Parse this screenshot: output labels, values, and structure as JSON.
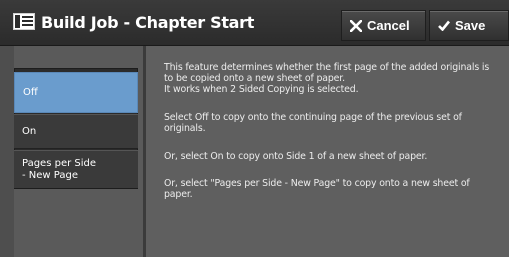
{
  "header": {
    "title": "Build Job - Chapter Start",
    "icon": "document-list-icon",
    "cancel_label": "Cancel",
    "save_label": "Save"
  },
  "options": [
    {
      "label": "Off",
      "selected": true
    },
    {
      "label": "On",
      "selected": false
    },
    {
      "label": "Pages per Side\n- New Page",
      "selected": false
    }
  ],
  "description": {
    "p1": "This feature determines whether the first page of the added originals is to be copied onto a new sheet of paper.\nIt works when 2 Sided Copying is selected.",
    "p2": "Select Off to copy onto the continuing page of the previous set of originals.",
    "p3": "Or, select On to copy onto Side 1 of a new sheet of paper.",
    "p4": "Or, select \"Pages per Side - New Page\" to copy onto a new sheet of paper."
  },
  "colors": {
    "selected": "#6a9ccd",
    "panel": "#5f5f5f",
    "titlebar": "#2f2f2f"
  }
}
